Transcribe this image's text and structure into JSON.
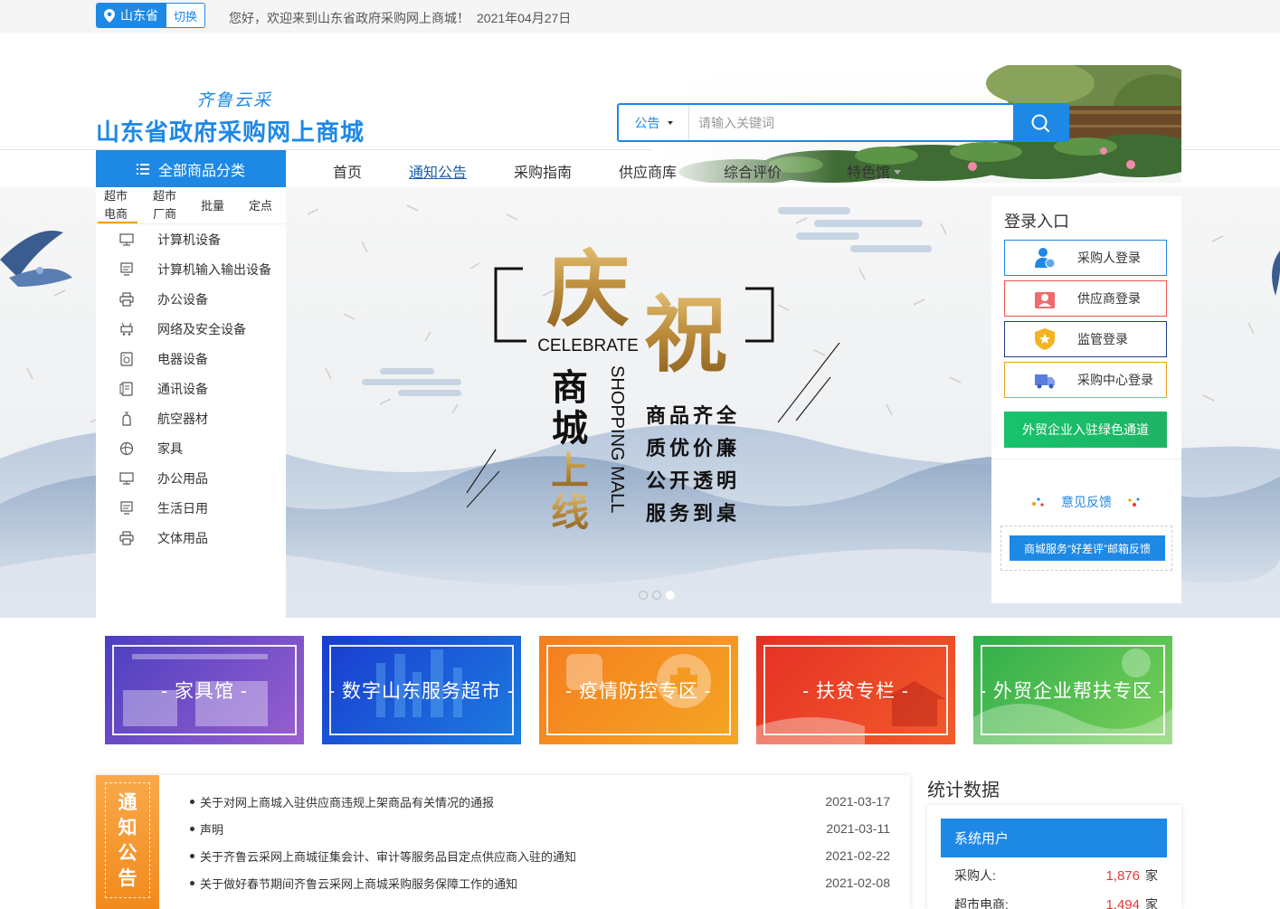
{
  "topbar": {
    "province": "山东省",
    "switch_label": "切换",
    "welcome": "您好，欢迎来到山东省政府采购网上商城！",
    "date": "2021年04月27日"
  },
  "header": {
    "logo_sub": "齐鲁云采",
    "logo_main": "山东省政府采购网上商城",
    "search_type": "公告",
    "search_placeholder": "请输入关键词"
  },
  "nav": {
    "all_categories": "全部商品分类",
    "items": [
      "首页",
      "通知公告",
      "采购指南",
      "供应商库",
      "综合评价",
      "特色馆"
    ]
  },
  "categories": {
    "tabs": [
      [
        "超市",
        "电商"
      ],
      [
        "超市",
        "厂商"
      ],
      [
        "批量"
      ],
      [
        "定点"
      ]
    ],
    "items": [
      {
        "label": "计算机设备",
        "icon": "monitor-icon"
      },
      {
        "label": "计算机输入输出设备",
        "icon": "monitor-stand-icon"
      },
      {
        "label": "办公设备",
        "icon": "printer-icon"
      },
      {
        "label": "网络及安全设备",
        "icon": "network-icon"
      },
      {
        "label": "电器设备",
        "icon": "appliance-icon"
      },
      {
        "label": "通讯设备",
        "icon": "phone-icon"
      },
      {
        "label": "航空器材",
        "icon": "aircraft-icon"
      },
      {
        "label": "家具",
        "icon": "ball-icon"
      },
      {
        "label": "办公用品",
        "icon": "monitor-icon"
      },
      {
        "label": "生活日用",
        "icon": "monitor-stand-icon"
      },
      {
        "label": "文体用品",
        "icon": "printer-icon"
      }
    ]
  },
  "banner": {
    "big1": "庆",
    "big2": "祝",
    "celebrate": "CELEBRATE",
    "shop1": "商",
    "shop2": "城",
    "shop3": "上",
    "shop4": "线",
    "mall": "SHOPPING MALL",
    "slogans": [
      "商品齐全",
      "质优价廉",
      "公开透明",
      "服务到桌"
    ],
    "slide_count": 3,
    "active_slide": 3
  },
  "login": {
    "title": "登录入口",
    "buttons": [
      {
        "label": "采购人登录",
        "color": "#1e88e5",
        "icon": "purchaser-icon"
      },
      {
        "label": "供应商登录",
        "color": "#ef5350",
        "icon": "supplier-icon"
      },
      {
        "label": "监管登录",
        "color": "#1a3c8c",
        "icon": "shield-icon"
      },
      {
        "label": "采购中心登录",
        "color": "#f0a020",
        "icon": "truck-icon"
      }
    ],
    "foreign_trade": "外贸企业入驻绿色通道",
    "feedback": "意见反馈",
    "mail_feedback": "商城服务“好差评”邮箱反馈"
  },
  "zones": [
    {
      "label": "- 家具馆 -",
      "from": "#4b3fbf",
      "to": "#9a5fd0"
    },
    {
      "label": "- 数字山东服务超市 -",
      "from": "#1a3bd0",
      "to": "#1c7de0"
    },
    {
      "label": "- 疫情防控专区 -",
      "from": "#f57d1f",
      "to": "#f5a623"
    },
    {
      "label": "- 扶贫专栏 -",
      "from": "#e53025",
      "to": "#f25c2a"
    },
    {
      "label": "- 外贸企业帮扶专区 -",
      "from": "#2fae4a",
      "to": "#7bd05a"
    }
  ],
  "notice": {
    "badge": [
      "通",
      "知",
      "公",
      "告"
    ],
    "items": [
      {
        "title": "关于对网上商城入驻供应商违规上架商品有关情况的通报",
        "date": "2021-03-17"
      },
      {
        "title": "声明",
        "date": "2021-03-11"
      },
      {
        "title": "关于齐鲁云采网上商城征集会计、审计等服务品目定点供应商入驻的通知",
        "date": "2021-02-22"
      },
      {
        "title": "关于做好春节期间齐鲁云采网上商城采购服务保障工作的通知",
        "date": "2021-02-08"
      }
    ]
  },
  "stats": {
    "title": "统计数据",
    "panel_title": "系统用户",
    "rows": [
      {
        "label": "采购人:",
        "value": "1,876",
        "unit": "家"
      },
      {
        "label": "超市电商:",
        "value": "1,494",
        "unit": "家"
      }
    ]
  }
}
